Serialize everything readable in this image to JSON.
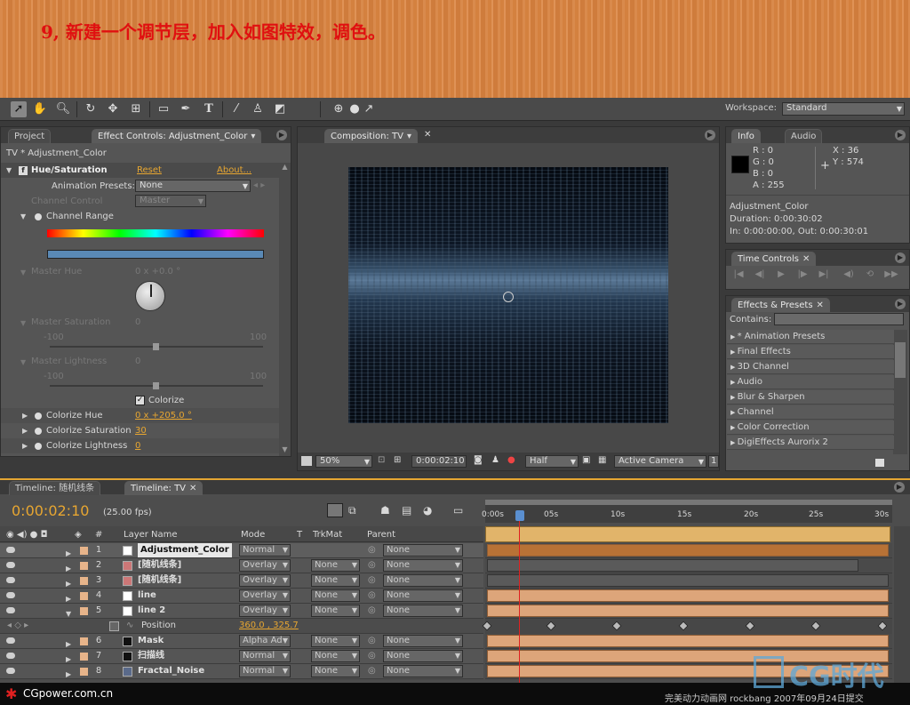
{
  "banner": {
    "title": "9, 新建一个调节层，加入如图特效，调色。"
  },
  "toolbar": {
    "tools": [
      "selection-tool",
      "hand-tool",
      "zoom-tool",
      "rotate-tool",
      "camera-tool",
      "pan-tool",
      "rectangle-mask-tool",
      "pen-tool",
      "type-tool",
      "brush-tool",
      "clone-tool",
      "eraser-tool"
    ],
    "workspace_label": "Workspace:",
    "workspace_value": "Standard"
  },
  "left_panel": {
    "tab_project": "Project",
    "tab_effect_controls": "Effect Controls: Adjustment_Color",
    "breadcrumb": "TV * Adjustment_Color",
    "effect_name": "Hue/Saturation",
    "reset": "Reset",
    "about": "About...",
    "animation_presets_label": "Animation Presets:",
    "animation_presets_value": "None",
    "channel_control_label": "Channel Control",
    "channel_control_value": "Master",
    "channel_range_label": "Channel Range",
    "master_hue_label": "Master Hue",
    "master_hue_value": "0 x +0.0 °",
    "master_saturation_label": "Master Saturation",
    "master_saturation_value": "0",
    "sat_min": "-100",
    "sat_max": "100",
    "master_lightness_label": "Master Lightness",
    "master_lightness_value": "0",
    "light_min": "-100",
    "light_max": "100",
    "colorize_label": "Colorize",
    "colorize_hue_label": "Colorize Hue",
    "colorize_hue_value": "0 x +205.0 °",
    "colorize_saturation_label": "Colorize Saturation",
    "colorize_saturation_value": "30",
    "colorize_lightness_label": "Colorize Lightness",
    "colorize_lightness_value": "0"
  },
  "comp_panel": {
    "tab": "Composition: TV",
    "zoom": "50%",
    "timecode": "0:00:02:10",
    "resolution": "Half",
    "camera": "Active Camera",
    "views": "1"
  },
  "info_panel": {
    "tab_info": "Info",
    "tab_audio": "Audio",
    "r": "R : 0",
    "g": "G : 0",
    "b": "B : 0",
    "a": "A : 255",
    "x": "X : 36",
    "y": "Y : 574",
    "layer": "Adjustment_Color",
    "duration": "Duration: 0:00:30:02",
    "in_out": "In: 0:00:00:00, Out: 0:00:30:01"
  },
  "time_controls": {
    "tab": "Time Controls"
  },
  "effects_presets": {
    "tab": "Effects & Presets",
    "contains_label": "Contains:",
    "items": [
      "* Animation Presets",
      "Final Effects",
      "3D Channel",
      "Audio",
      "Blur & Sharpen",
      "Channel",
      "Color Correction",
      "DigiEffects Aurorix 2"
    ]
  },
  "timeline": {
    "tab1": "Timeline: 随机线条",
    "tab2": "Timeline: TV",
    "current_time": "0:00:02:10",
    "fps": "(25.00 fps)",
    "col_number": "#",
    "col_layer_name": "Layer Name",
    "col_mode": "Mode",
    "col_t": "T",
    "col_trkmat": "TrkMat",
    "col_parent": "Parent",
    "ruler": [
      "0:00s",
      "05s",
      "10s",
      "15s",
      "20s",
      "25s",
      "30s"
    ],
    "layers": [
      {
        "num": "1",
        "name": "Adjustment_Color",
        "mode": "Normal",
        "trkmat": "",
        "parent": "None"
      },
      {
        "num": "2",
        "name": "[随机线条]",
        "mode": "Overlay",
        "trkmat": "None",
        "parent": "None"
      },
      {
        "num": "3",
        "name": "[随机线条]",
        "mode": "Overlay",
        "trkmat": "None",
        "parent": "None"
      },
      {
        "num": "4",
        "name": "line",
        "mode": "Overlay",
        "trkmat": "None",
        "parent": "None"
      },
      {
        "num": "5",
        "name": "line 2",
        "mode": "Overlay",
        "trkmat": "None",
        "parent": "None"
      },
      {
        "num": "6",
        "name": "Mask",
        "mode": "Alpha Ad",
        "trkmat": "None",
        "parent": "None"
      },
      {
        "num": "7",
        "name": "扫描线",
        "mode": "Normal",
        "trkmat": "None",
        "parent": "None"
      },
      {
        "num": "8",
        "name": "Fractal_Noise",
        "mode": "Normal",
        "trkmat": "None",
        "parent": "None"
      }
    ],
    "position_label": "Position",
    "position_value": "360.0 , 325.7"
  },
  "footer": {
    "site": "CGpower.com.cn",
    "credit": "完美动力动画网 rockbang 2007年09月24日提交",
    "logo": "CG时代"
  }
}
